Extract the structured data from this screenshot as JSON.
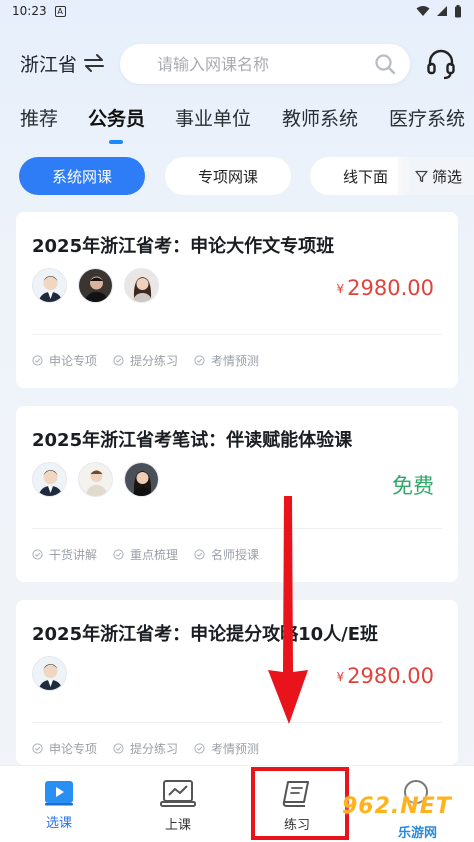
{
  "status_bar": {
    "time": "10:23",
    "notification_icon": "a-notification-icon"
  },
  "header": {
    "province": "浙江省",
    "search_placeholder": "请输入网课名称",
    "icons": [
      "swap-icon",
      "search-icon",
      "headset-icon"
    ]
  },
  "tabs": [
    {
      "label": "推荐",
      "active": false
    },
    {
      "label": "公务员",
      "active": true
    },
    {
      "label": "事业单位",
      "active": false
    },
    {
      "label": "教师系统",
      "active": false
    },
    {
      "label": "医疗系统",
      "active": false
    }
  ],
  "chips": [
    {
      "label": "系统网课",
      "active": true
    },
    {
      "label": "专项网课",
      "active": false
    },
    {
      "label": "线下面",
      "active": false
    }
  ],
  "filter_label": "筛选",
  "courses": [
    {
      "title": "2025年浙江省考：申论大作文专项班",
      "currency": "¥",
      "price": "2980.00",
      "tags": [
        "申论专项",
        "提分练习",
        "考情预测"
      ]
    },
    {
      "title": "2025年浙江省考笔试：伴读赋能体验课",
      "price_free": "免费",
      "tags": [
        "干货讲解",
        "重点梳理",
        "名师授课"
      ]
    },
    {
      "title": "2025年浙江省考：申论提分攻略10人/E班",
      "currency": "¥",
      "price": "2980.00",
      "tags": [
        "申论专项",
        "提分练习",
        "考情预测"
      ]
    }
  ],
  "bottom_nav": [
    {
      "label": "选课",
      "icon": "play-video-icon",
      "active": true
    },
    {
      "label": "上课",
      "icon": "laptop-chart-icon",
      "active": false
    },
    {
      "label": "练习",
      "icon": "notebook-icon",
      "active": false
    },
    {
      "label": "",
      "icon": "profile-icon",
      "active": false
    }
  ],
  "watermark": {
    "main": "962.NET",
    "sub": "乐游网"
  },
  "colors": {
    "accent": "#2f7df6",
    "price_red": "#e0433c",
    "free_green": "#2fa86a",
    "annotation_red": "#e8131b"
  }
}
